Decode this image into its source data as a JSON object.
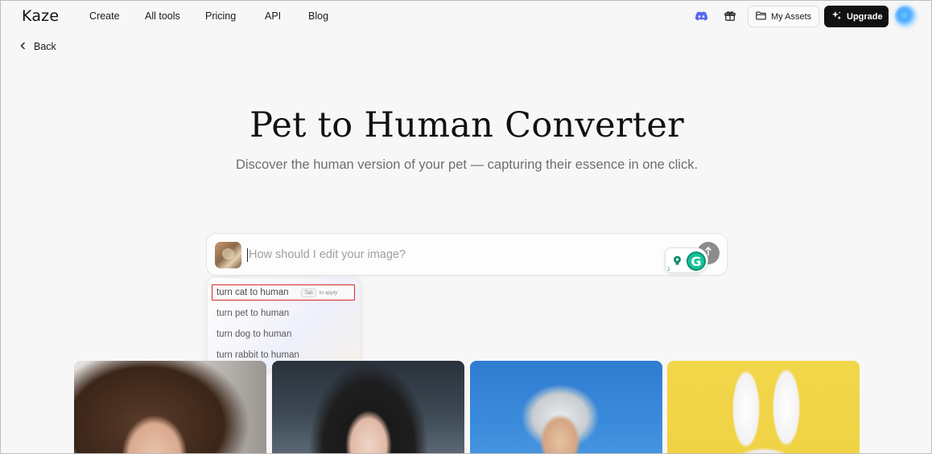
{
  "nav": {
    "logo": "Kaze",
    "links": [
      "Create",
      "All tools",
      "Pricing",
      "API",
      "Blog"
    ],
    "my_assets_label": "My Assets",
    "upgrade_label": "Upgrade"
  },
  "back_label": "Back",
  "hero": {
    "title": "Pet to Human Converter",
    "subtitle": "Discover the human version of your pet — capturing their essence in one click."
  },
  "prompt": {
    "placeholder": "How should I edit your image?",
    "value": ""
  },
  "suggestions": {
    "items": [
      "turn cat to human",
      "turn pet to human",
      "turn dog to human",
      "turn rabbit to human"
    ],
    "tab_key": "Tab",
    "tab_hint": "to apply"
  },
  "grammarly": {
    "count": "1"
  },
  "icons": {
    "discord": "discord-icon",
    "gift": "gift-icon",
    "folder": "folder-icon",
    "sparkle": "sparkle-icon",
    "back": "chevron-left-icon",
    "send": "arrow-up-icon"
  },
  "colors": {
    "background": "#f7f7f7",
    "upgrade_bg": "#111111",
    "discord": "#5865f2",
    "grammarly": "#15c39a",
    "highlight_border": "#d42a2a"
  }
}
